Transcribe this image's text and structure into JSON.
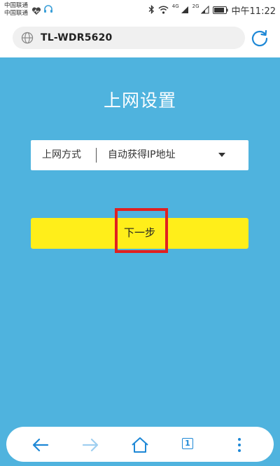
{
  "status_bar": {
    "carrier_1": "中国联通",
    "carrier_2": "中国联通",
    "net_4g": "4G",
    "net_2g": "2G",
    "time": "中午11:22",
    "icons": [
      "heart-icon",
      "headset-icon",
      "bluetooth-icon",
      "wifi-icon",
      "signal-icon",
      "battery-icon"
    ]
  },
  "address_bar": {
    "url": "TL-WDR5620",
    "icons": [
      "globe-icon",
      "reload-icon"
    ]
  },
  "page": {
    "title": "上网设置",
    "connection": {
      "label": "上网方式",
      "selected": "自动获得IP地址"
    },
    "next_button_label": "下一步"
  },
  "toolbar": {
    "tab_count": "1",
    "icons": [
      "back-arrow-icon",
      "forward-arrow-icon",
      "home-icon",
      "tabs-icon",
      "more-menu-icon"
    ]
  },
  "colors": {
    "page_background": "#4fb3de",
    "button_yellow": "#ffee1a",
    "highlight_red": "#e02020",
    "accent_blue": "#1e88d6"
  }
}
